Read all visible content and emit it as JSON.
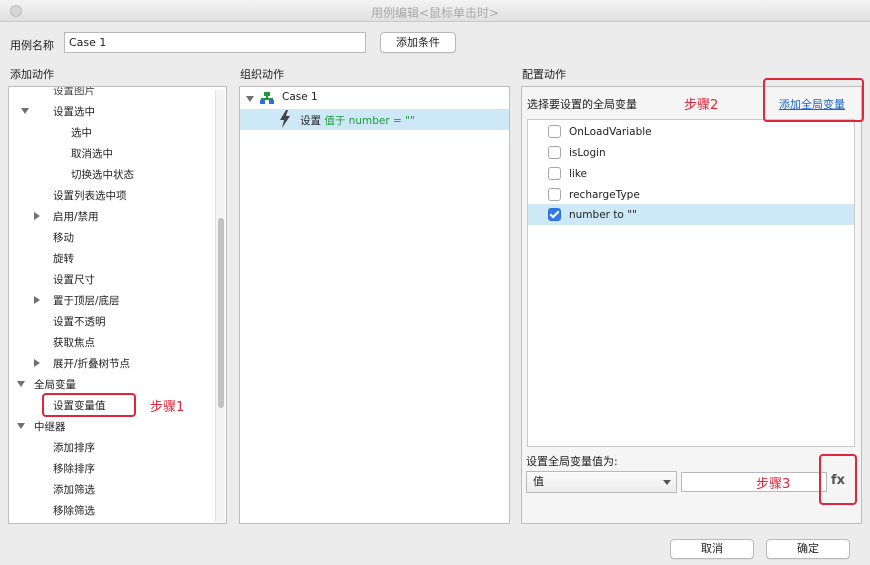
{
  "window": {
    "title": "用例编辑<鼠标单击时>"
  },
  "case_name": {
    "label": "用例名称",
    "value": "Case 1"
  },
  "add_condition_label": "添加条件",
  "add_actions": {
    "header": "添加动作",
    "items": [
      {
        "text": "设置图片"
      },
      {
        "text": "设置选中"
      },
      {
        "text": "选中"
      },
      {
        "text": "取消选中"
      },
      {
        "text": "切换选中状态"
      },
      {
        "text": "设置列表选中项"
      },
      {
        "text": "启用/禁用"
      },
      {
        "text": "移动"
      },
      {
        "text": "旋转"
      },
      {
        "text": "设置尺寸"
      },
      {
        "text": "置于顶层/底层"
      },
      {
        "text": "设置不透明"
      },
      {
        "text": "获取焦点"
      },
      {
        "text": "展开/折叠树节点"
      },
      {
        "text": "全局变量"
      },
      {
        "text": "设置变量值"
      },
      {
        "text": "中继器"
      },
      {
        "text": "添加排序"
      },
      {
        "text": "移除排序"
      },
      {
        "text": "添加筛选"
      },
      {
        "text": "移除筛选"
      }
    ],
    "annotation": "步骤1"
  },
  "organize": {
    "header": "组织动作",
    "case_label": "Case 1",
    "action": {
      "prefix": "设置",
      "detail": "值于 number = \"\""
    }
  },
  "configure": {
    "header": "配置动作",
    "subheader": "选择要设置的全局变量",
    "annotation2": "步骤2",
    "add_global_link": "添加全局变量",
    "variables": [
      {
        "name": "OnLoadVariable",
        "checked": false
      },
      {
        "name": "isLogin",
        "checked": false
      },
      {
        "name": "like",
        "checked": false
      },
      {
        "name": "rechargeType",
        "checked": false
      },
      {
        "name": "number to \"\"",
        "checked": true
      }
    ],
    "set_value_label": "设置全局变量值为:",
    "select_value": "值",
    "value_input": "",
    "annotation3": "步骤3",
    "fx_label": "fx"
  },
  "footer": {
    "cancel": "取消",
    "ok": "确定"
  },
  "colors": {
    "annotation": "#e0263a",
    "selection": "#cde8f6",
    "link": "#1a64c8",
    "checkbox": "#2f7be8",
    "green_text": "#1d9a3c"
  }
}
